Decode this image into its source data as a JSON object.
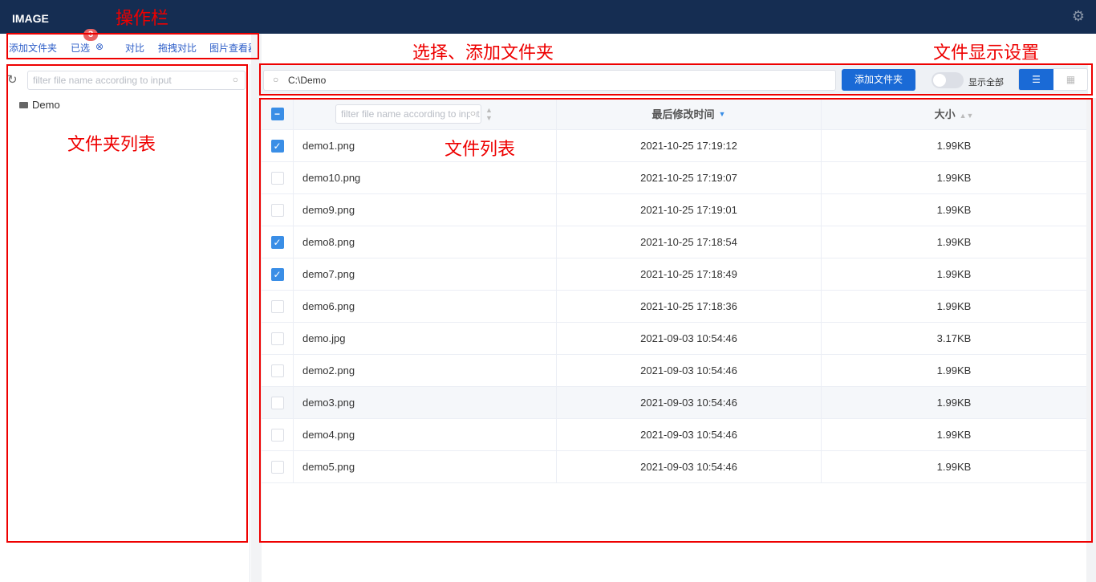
{
  "header": {
    "title": "IMAGE",
    "settings_icon": "gear-icon"
  },
  "toolbar": {
    "add_folder": "添加文件夹",
    "selected": "已选",
    "selected_count": "3",
    "compare": "对比",
    "drag_compare": "拖拽对比",
    "image_viewer": "图片查看器"
  },
  "sidebar": {
    "filter_placeholder": "filter file name according to input",
    "folders": [
      "Demo"
    ]
  },
  "pathbar": {
    "path": "C:\\Demo",
    "add_button": "添加文件夹",
    "show_all_label": "显示全部",
    "show_all": false,
    "view_mode": "list"
  },
  "table": {
    "name_filter_placeholder": "filter file name according to input",
    "col_time": "最后修改时间",
    "col_size": "大小",
    "rows": [
      {
        "name": "demo1.png",
        "time": "2021-10-25 17:19:12",
        "size": "1.99KB",
        "checked": true
      },
      {
        "name": "demo10.png",
        "time": "2021-10-25 17:19:07",
        "size": "1.99KB",
        "checked": false
      },
      {
        "name": "demo9.png",
        "time": "2021-10-25 17:19:01",
        "size": "1.99KB",
        "checked": false
      },
      {
        "name": "demo8.png",
        "time": "2021-10-25 17:18:54",
        "size": "1.99KB",
        "checked": true
      },
      {
        "name": "demo7.png",
        "time": "2021-10-25 17:18:49",
        "size": "1.99KB",
        "checked": true
      },
      {
        "name": "demo6.png",
        "time": "2021-10-25 17:18:36",
        "size": "1.99KB",
        "checked": false
      },
      {
        "name": "demo.jpg",
        "time": "2021-09-03 10:54:46",
        "size": "3.17KB",
        "checked": false
      },
      {
        "name": "demo2.png",
        "time": "2021-09-03 10:54:46",
        "size": "1.99KB",
        "checked": false
      },
      {
        "name": "demo3.png",
        "time": "2021-09-03 10:54:46",
        "size": "1.99KB",
        "checked": false
      },
      {
        "name": "demo4.png",
        "time": "2021-09-03 10:54:46",
        "size": "1.99KB",
        "checked": false
      },
      {
        "name": "demo5.png",
        "time": "2021-09-03 10:54:46",
        "size": "1.99KB",
        "checked": false
      }
    ]
  },
  "annotations": {
    "toolbar": "操作栏",
    "pathbar": "选择、添加文件夹",
    "display": "文件显示设置",
    "folders": "文件夹列表",
    "files": "文件列表"
  }
}
